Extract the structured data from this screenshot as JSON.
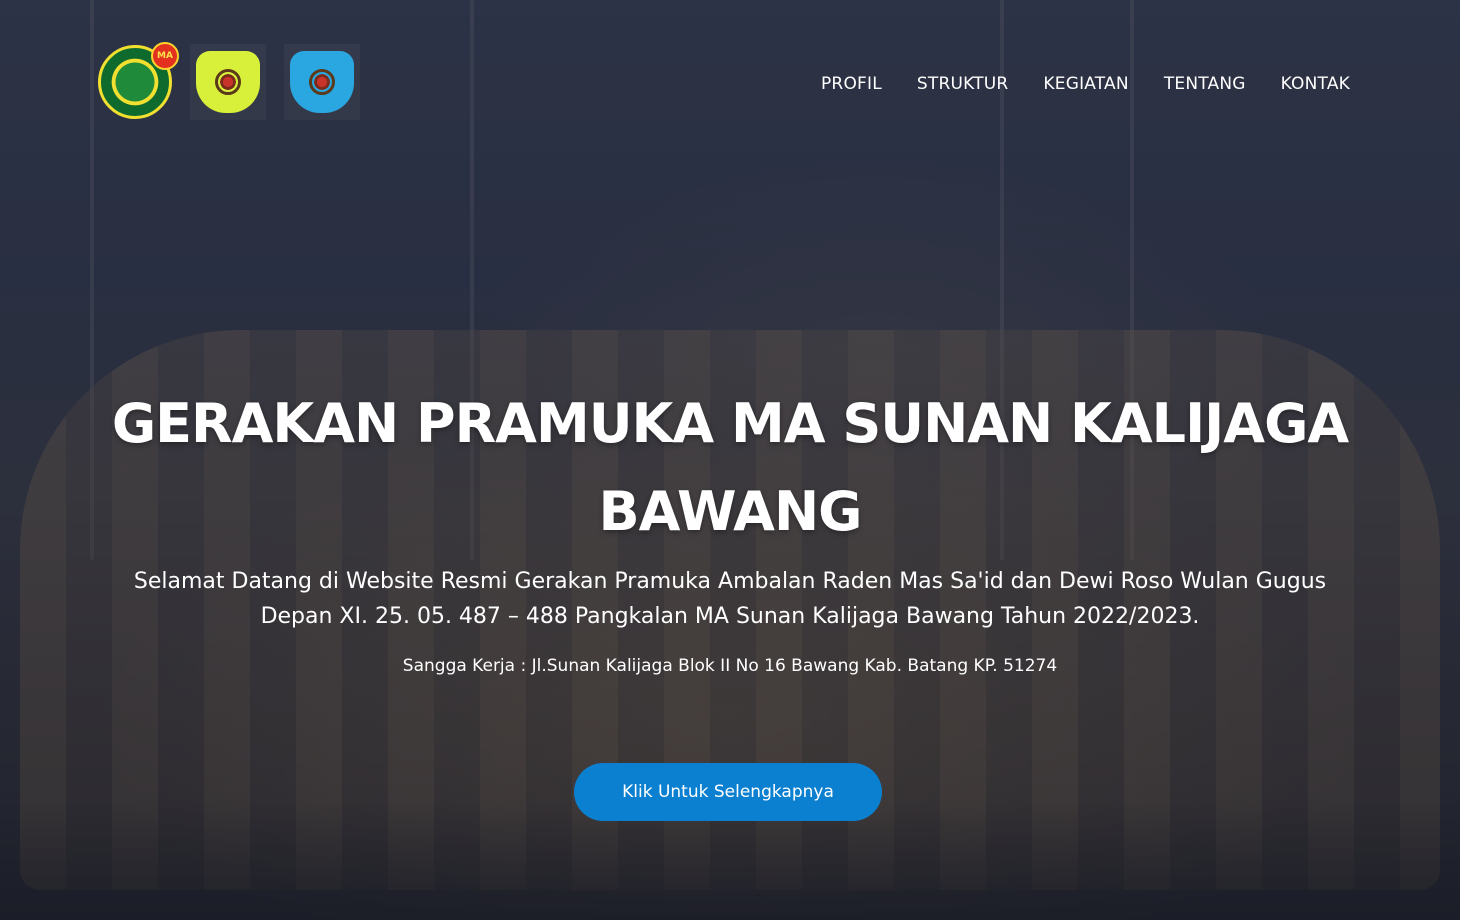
{
  "header": {
    "logos": [
      {
        "badge": "MA"
      },
      {
        "accent": "#d9f03a"
      },
      {
        "accent": "#2aa6e0"
      }
    ],
    "nav": [
      "PROFIL",
      "STRUKTUR",
      "KEGIATAN",
      "TENTANG",
      "KONTAK"
    ]
  },
  "hero": {
    "title": "GERAKAN PRAMUKA MA SUNAN KALIJAGA BAWANG",
    "subtitle": "Selamat Datang di Website Resmi Gerakan Pramuka Ambalan Raden Mas Sa'id dan Dewi Roso Wulan Gugus Depan XI. 25. 05. 487 – 488 Pangkalan MA Sunan Kalijaga Bawang Tahun 2022/2023.",
    "address": "Sangga Kerja : Jl.Sunan Kalijaga Blok II No 16 Bawang Kab. Batang KP. 51274",
    "cta_label": "Klik Untuk Selengkapnya"
  },
  "colors": {
    "cta_bg": "#0b7fd0",
    "text": "#ffffff"
  }
}
